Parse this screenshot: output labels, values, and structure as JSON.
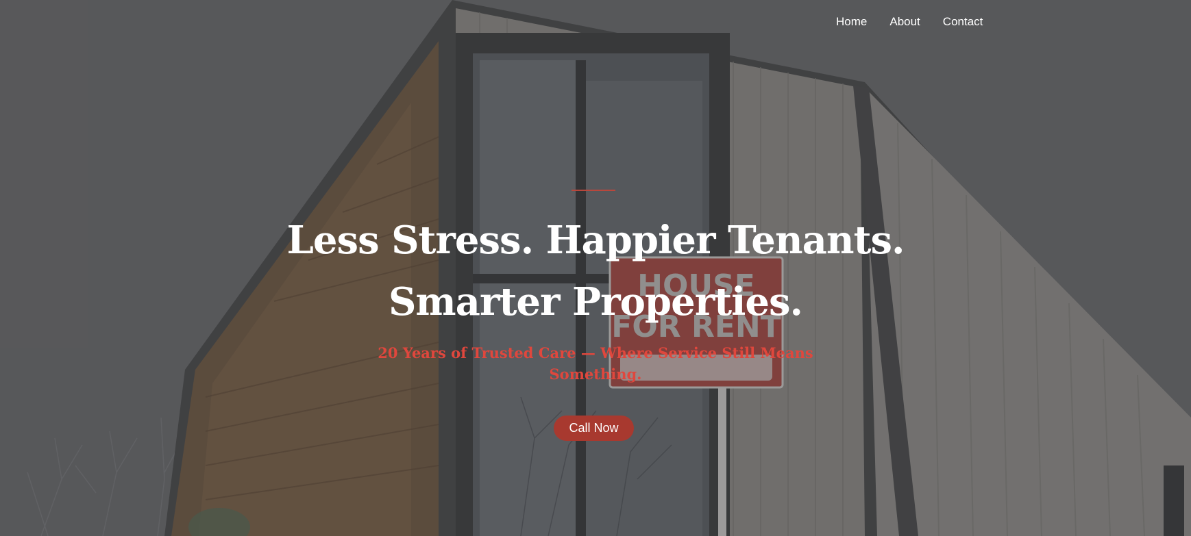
{
  "nav": {
    "items": [
      {
        "label": "Home"
      },
      {
        "label": "About"
      },
      {
        "label": "Contact"
      }
    ]
  },
  "hero": {
    "headline_line1": "Less Stress. Happier Tenants.",
    "headline_line2": "Smarter Properties.",
    "subheadline": "20 Years of Trusted Care — Where Service Still Means Something.",
    "cta_label": "Call Now",
    "background_image": "modern-wooden-house-with-for-rent-sign",
    "sign_text_line1": "HOUSE",
    "sign_text_line2": "FOR RENT"
  },
  "colors": {
    "accent": "#a8392f",
    "subheadline": "#e0473d",
    "divider": "#b9473c",
    "text": "#ffffff"
  }
}
